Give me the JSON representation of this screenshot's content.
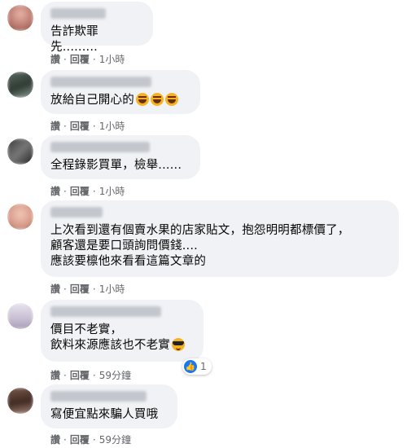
{
  "actions": {
    "like": "讚",
    "reply": "回覆",
    "sep": "·"
  },
  "comments": [
    {
      "text": "告詐欺罪先.........",
      "time": "1小時"
    },
    {
      "text": "放給自己開心的",
      "time": "1小時"
    },
    {
      "text": "全程錄影買單，檢舉......",
      "time": "1小時"
    },
    {
      "text": "上次看到還有個賣水果的店家貼文，抱怨明明都標價了，\n顧客還是要口頭詢問價錢....\n應該要檩他來看看這篇文章的",
      "time": "1小時"
    },
    {
      "text": "價目不老實，\n飲料來源應該也不老實",
      "time": "59分鐘",
      "reaction_count": "1"
    },
    {
      "text": "寫便宜點來騙人買哦",
      "time": "59分鐘"
    }
  ],
  "colors": {
    "bubble": "#f0f2f5",
    "meta": "#65676b",
    "like": "#1877f2"
  }
}
